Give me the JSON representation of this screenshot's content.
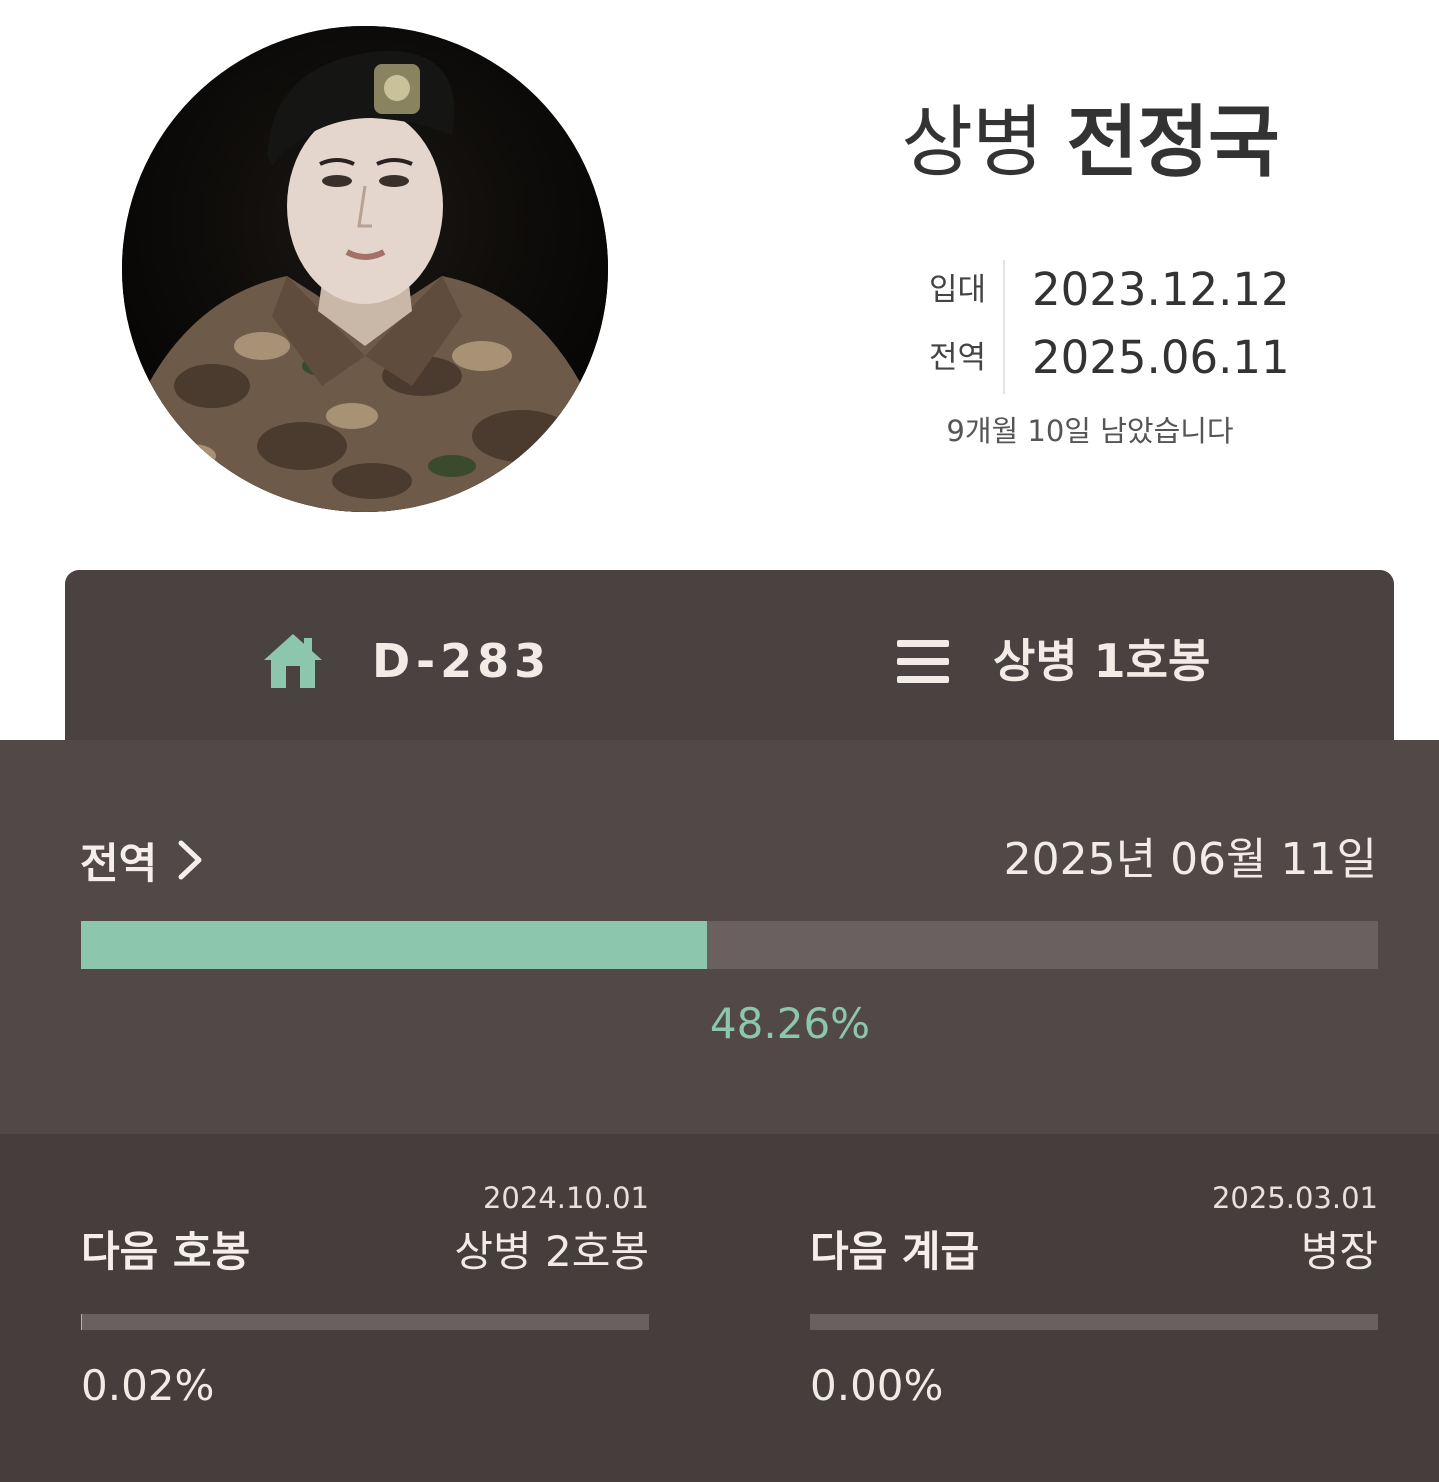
{
  "profile": {
    "rank": "상병",
    "name": "전정국",
    "dates": [
      {
        "label": "입대",
        "value": "2023.12.12"
      },
      {
        "label": "전역",
        "value": "2025.06.11"
      }
    ],
    "remaining": "9개월 10일 남았습니다"
  },
  "header_tabs": {
    "dday": "D-283",
    "rank_step": "상병 1호봉",
    "home_icon": "home-icon",
    "menu_icon": "menu-icon"
  },
  "discharge": {
    "label": "전역",
    "date": "2025년 06월 11일",
    "percent_text": "48.26%",
    "progress": 48.26
  },
  "next": [
    {
      "date": "2024.10.01",
      "title": "다음 호봉",
      "value": "상병 2호봉",
      "percent_text": "0.02%",
      "progress": 0.02
    },
    {
      "date": "2025.03.01",
      "title": "다음 계급",
      "value": "병장",
      "percent_text": "0.00%",
      "progress": 0.0
    }
  ],
  "colors": {
    "accent": "#8cc6ad",
    "card_dark": "#4a4141",
    "panel": "#524848",
    "panel_bottom": "#463d3d",
    "text_light": "#f2ece6"
  }
}
